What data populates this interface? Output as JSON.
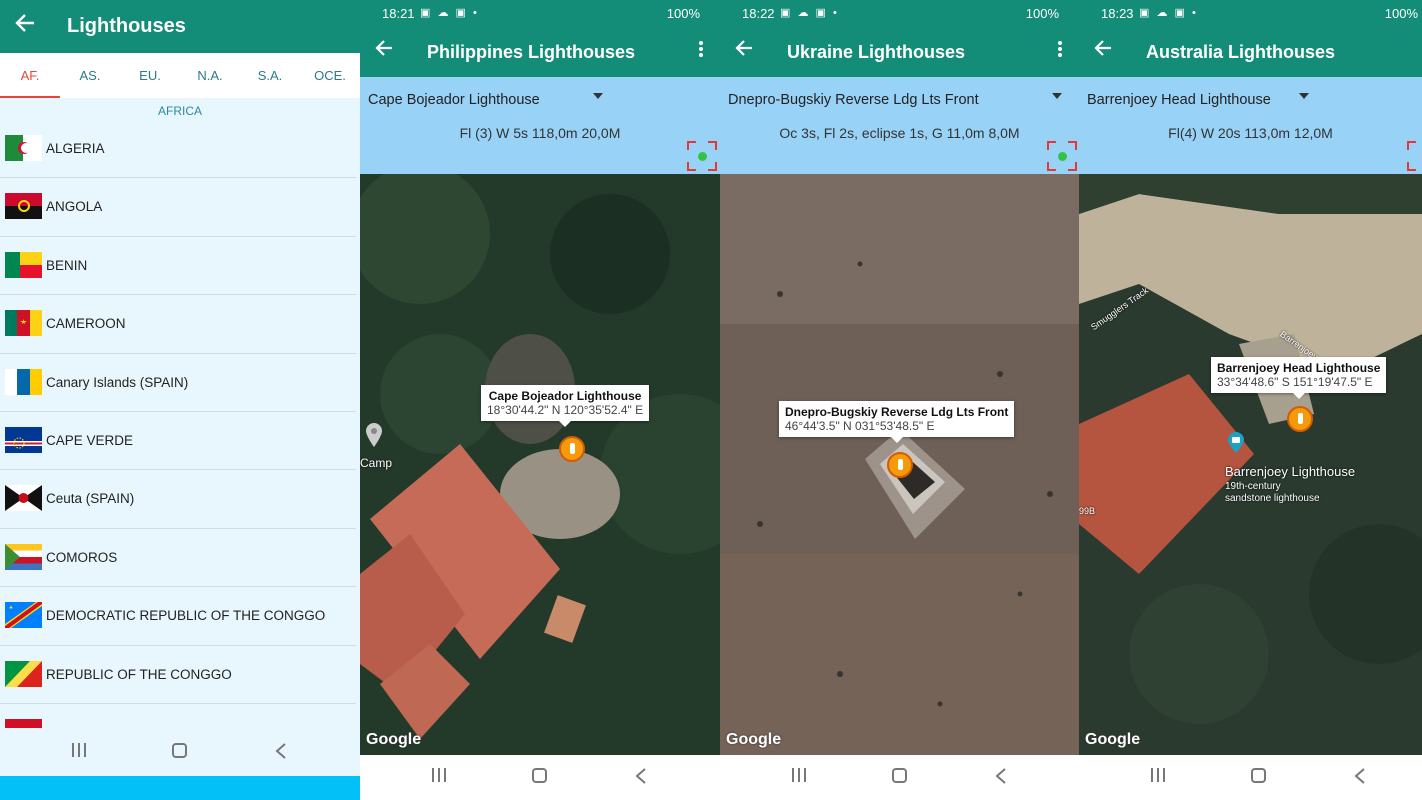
{
  "p1": {
    "title": "Lighthouses",
    "tabs": [
      "AF.",
      "AS.",
      "EU.",
      "N.A.",
      "S.A.",
      "OCE."
    ],
    "region": "AFRICA",
    "countries": [
      "ALGERIA",
      "ANGOLA",
      "BENIN",
      "CAMEROON",
      "Canary Islands (SPAIN)",
      "CAPE VERDE",
      "Ceuta (SPAIN)",
      "COMOROS",
      "DEMOCRATIC REPUBLIC OF THE CONGGO",
      "REPUBLIC OF THE CONGGO",
      ""
    ]
  },
  "p2": {
    "time": "18:21",
    "battery": "100%",
    "title": "Philippines Lighthouses",
    "selected": "Cape Bojeador Lighthouse",
    "info": "Fl (3) W 5s 118,0m 20,0M",
    "bubble_title": "Cape Bojeador Lighthouse",
    "bubble_coords": "18°30'44.2\" N  120°35'52.4\" E",
    "place_label": "Camp",
    "google": "Google"
  },
  "p3": {
    "time": "18:22",
    "battery": "100%",
    "title": "Ukraine Lighthouses",
    "selected": "Dnepro-Bugskiy Reverse Ldg Lts  Front",
    "info": "Oc 3s, Fl 2s, eclipse 1s, G 11,0m 8,0M",
    "bubble_title": "Dnepro-Bugskiy Reverse Ldg Lts  Front",
    "bubble_coords": "46°44'3.5\" N  031°53'48.5\" E",
    "google": "Google"
  },
  "p4": {
    "time": "18:23",
    "battery": "100%",
    "title": "Australia Lighthouses",
    "selected": "Barrenjoey Head Lighthouse",
    "info": "Fl(4) W 20s 113,0m 12,0M",
    "bubble_title": "Barrenjoey Head Lighthouse",
    "bubble_coords": "33°34'48.6\" S  151°19'47.5\" E",
    "poi_name": "Barrenjoey Lighthouse",
    "poi_desc1": "19th-century",
    "poi_desc2": "sandstone lighthouse",
    "road1": "Smugglers Track",
    "road2": "Barrenjoey",
    "road3": "99B",
    "google": "Google"
  },
  "icons": {
    "back": "arrow-left-icon",
    "menu": "more-vertical-icon",
    "recents": "recents-icon",
    "home": "home-icon",
    "navback": "nav-back-icon"
  }
}
